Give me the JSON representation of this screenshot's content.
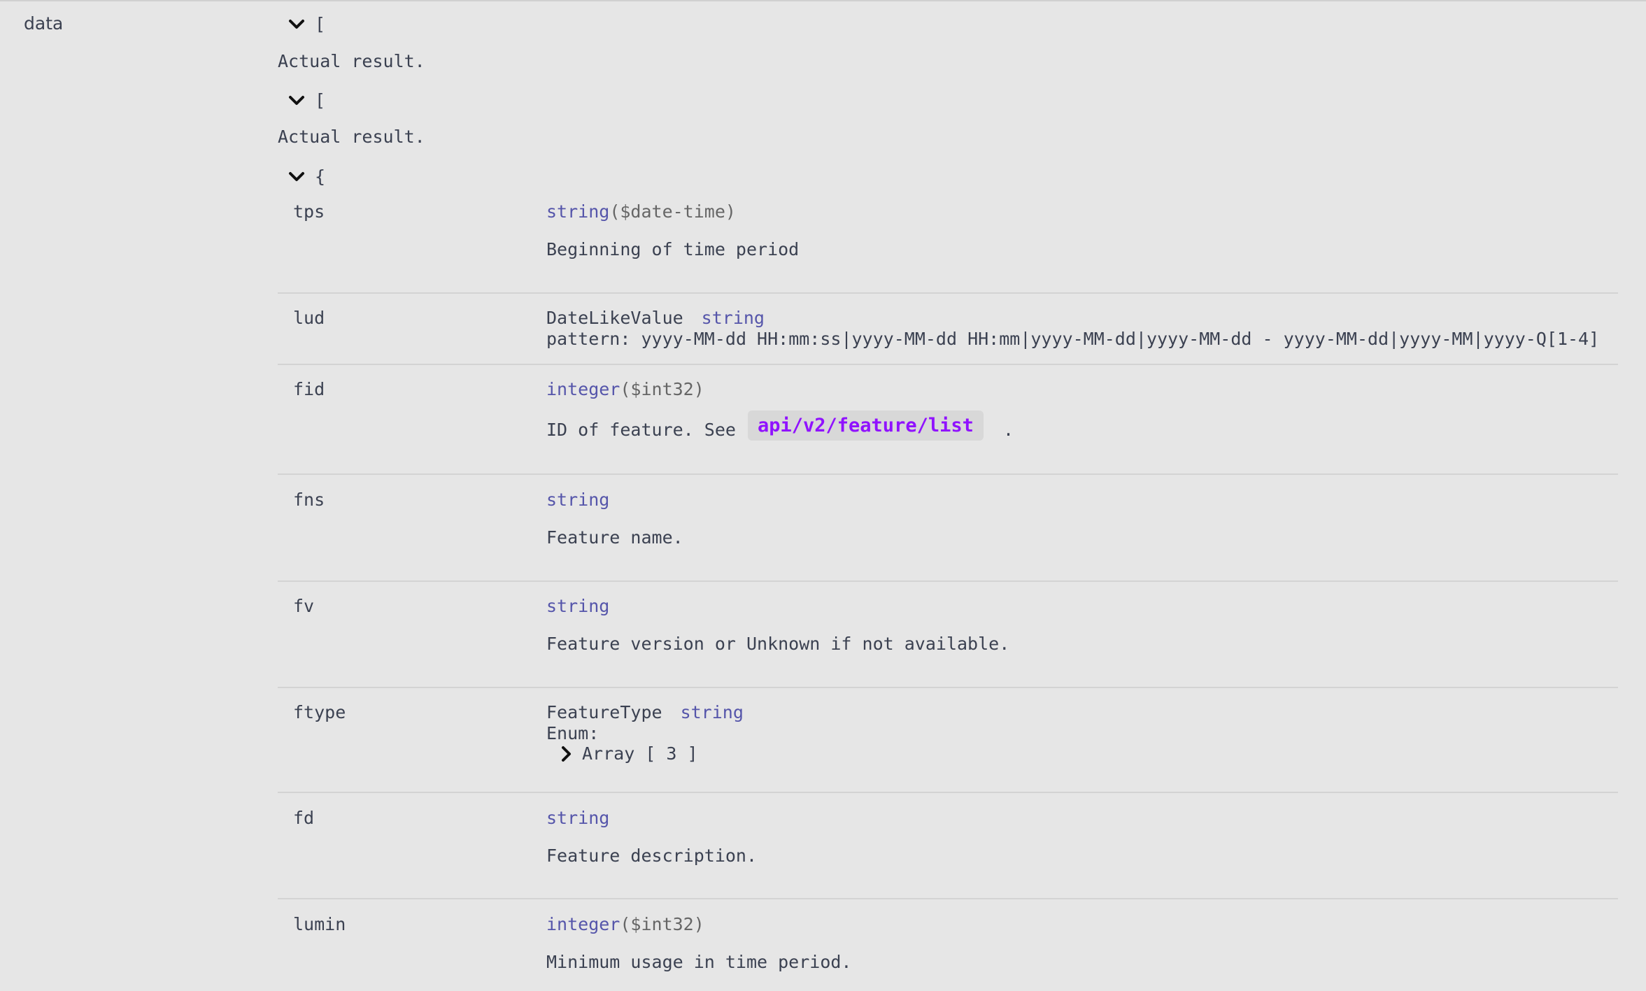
{
  "schema": {
    "root_key": "data",
    "outer_bracket": "[",
    "outer_description": "Actual result.",
    "inner_bracket": "[",
    "inner_description": "Actual result.",
    "object_bracket": "{",
    "properties": [
      {
        "name": "tps",
        "type": "string",
        "format": "($date-time)",
        "description": "Beginning of time period"
      },
      {
        "name": "lud",
        "model": "DateLikeValue",
        "type": "string",
        "pattern_label": "pattern:",
        "pattern": "yyyy-MM-dd HH:mm:ss|yyyy-MM-dd HH:mm|yyyy-MM-dd|yyyy-MM-dd - yyyy-MM-dd|yyyy-MM|yyyy-Q[1-4]"
      },
      {
        "name": "fid",
        "type": "integer",
        "format": "($int32)",
        "description_prefix": "ID of feature. See",
        "link": "api/v2/feature/list",
        "description_suffix": "."
      },
      {
        "name": "fns",
        "type": "string",
        "description": "Feature name."
      },
      {
        "name": "fv",
        "type": "string",
        "description": "Feature version or Unknown if not available."
      },
      {
        "name": "ftype",
        "model": "FeatureType",
        "type": "string",
        "enum_label": "Enum:",
        "enum_value": "Array [ 3 ]"
      },
      {
        "name": "fd",
        "type": "string",
        "description": "Feature description."
      },
      {
        "name": "lumin",
        "type": "integer",
        "format": "($int32)",
        "description": "Minimum usage in time period."
      }
    ]
  },
  "icons": {
    "expand": "chevron-down-icon",
    "collapsed": "chevron-right-icon"
  }
}
